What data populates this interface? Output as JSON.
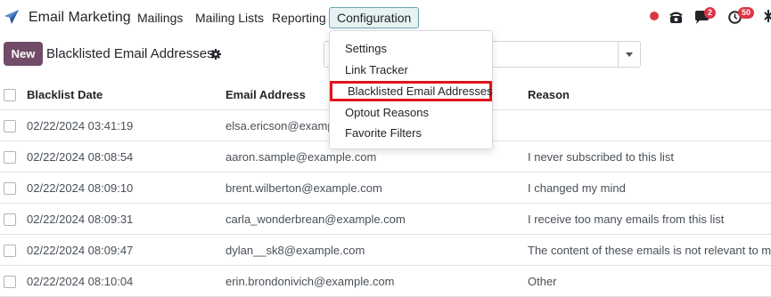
{
  "navbar": {
    "app_name": "Email Marketing",
    "menu": [
      "Mailings",
      "Mailing Lists",
      "Reporting",
      "Configuration"
    ],
    "active_menu": "Configuration",
    "systray": {
      "messages_badge": "2",
      "activities_badge": "50",
      "presence_color": "#dc3545"
    }
  },
  "control_panel": {
    "new_button": "New",
    "title": "Blacklisted Email Addresses"
  },
  "configuration_menu": {
    "items": [
      "Settings",
      "Link Tracker",
      "Blacklisted Email Addresses",
      "Optout Reasons",
      "Favorite Filters"
    ],
    "highlighted": "Blacklisted Email Addresses"
  },
  "table": {
    "columns": [
      "Blacklist Date",
      "Email Address",
      "Reason"
    ],
    "rows": [
      {
        "date": "02/22/2024 03:41:19",
        "email": "elsa.ericson@example.com",
        "reason": ""
      },
      {
        "date": "02/22/2024 08:08:54",
        "email": "aaron.sample@example.com",
        "reason": "I never subscribed to this list"
      },
      {
        "date": "02/22/2024 08:09:10",
        "email": "brent.wilberton@example.com",
        "reason": "I changed my mind"
      },
      {
        "date": "02/22/2024 08:09:31",
        "email": "carla_wonderbrean@example.com",
        "reason": "I receive too many emails from this list"
      },
      {
        "date": "02/22/2024 08:09:47",
        "email": "dylan__sk8@example.com",
        "reason": "The content of these emails is not relevant to me"
      },
      {
        "date": "02/22/2024 08:10:04",
        "email": "erin.brondonivich@example.com",
        "reason": "Other"
      }
    ]
  },
  "colors": {
    "brand": "#714b67",
    "active_menu_bg": "#e6f2f3",
    "highlight_border": "#e0121b",
    "badge": "#dc3545"
  }
}
